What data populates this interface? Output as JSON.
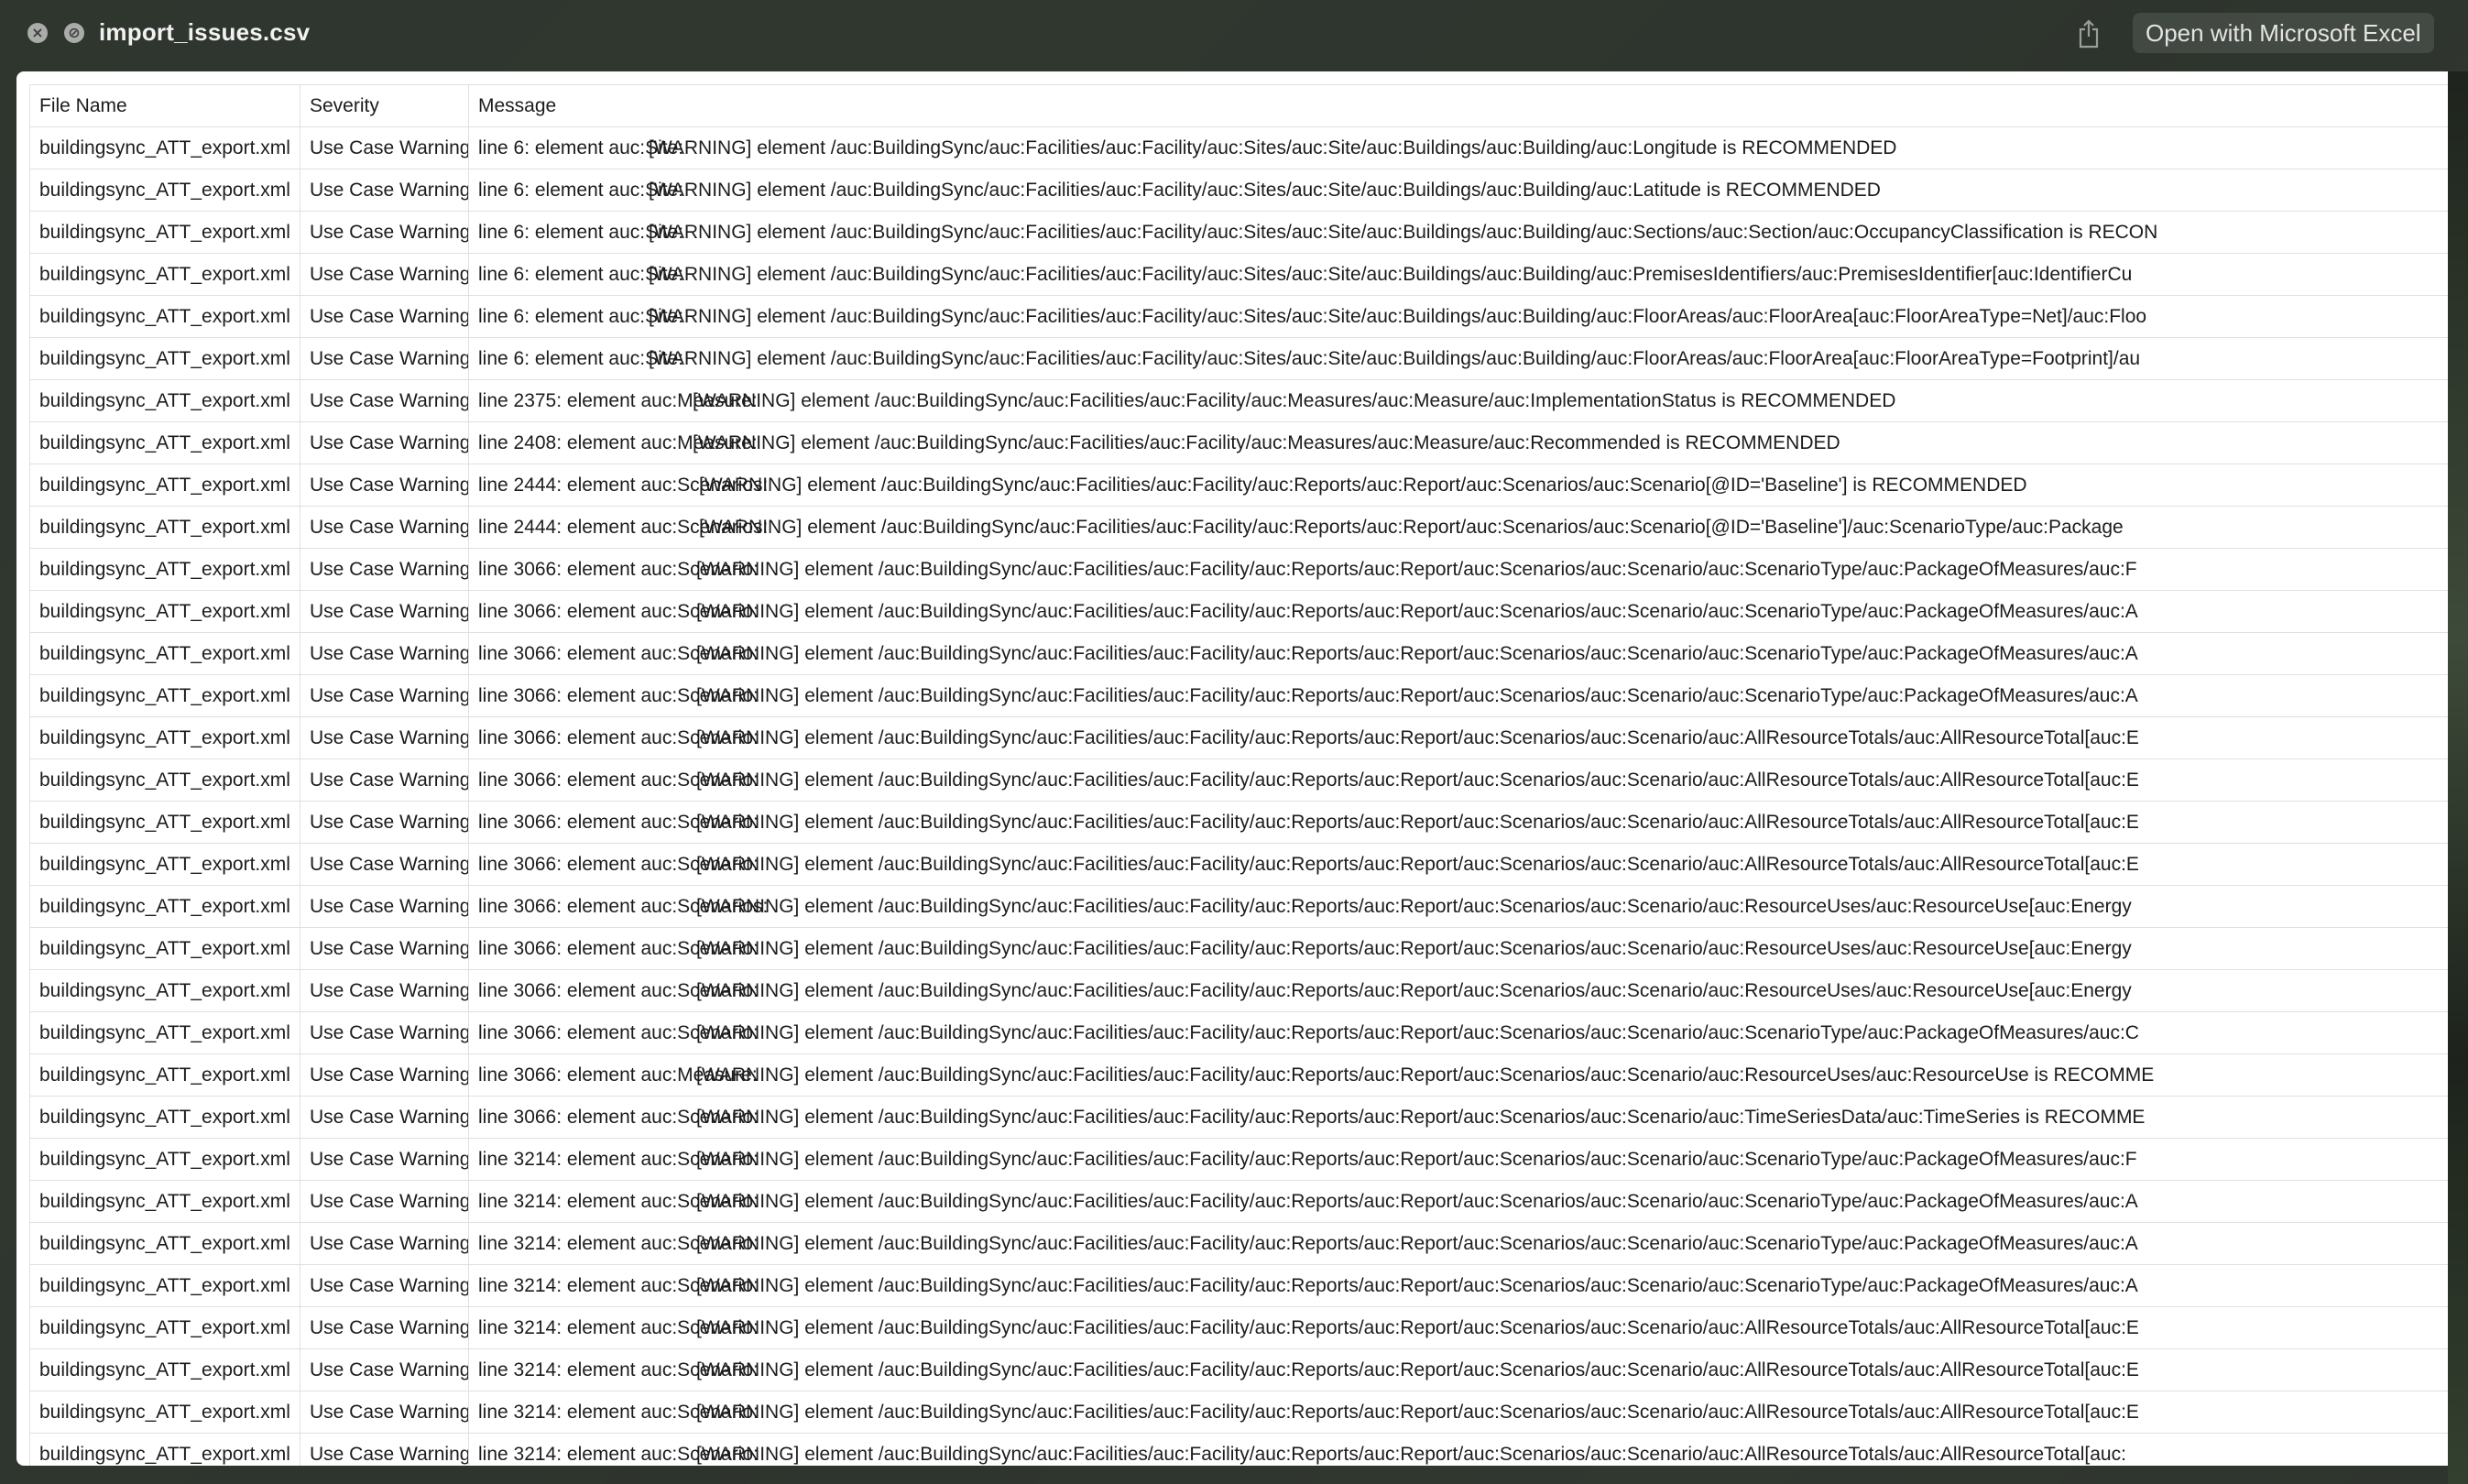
{
  "window": {
    "title": "import_issues.csv",
    "open_button_label": "Open with Microsoft Excel"
  },
  "icons": [
    "close-icon",
    "minimize-icon",
    "share-icon"
  ],
  "table": {
    "columns": [
      "File Name",
      "Severity",
      "Message"
    ],
    "rows": [
      {
        "file": "buildingsync_ATT_export.xml",
        "severity": "Use Case Warning",
        "line": "line 6: element auc:Site:",
        "text": "[WARNING] element /auc:BuildingSync/auc:Facilities/auc:Facility/auc:Sites/auc:Site/auc:Buildings/auc:Building/auc:Longitude is RECOMMENDED"
      },
      {
        "file": "buildingsync_ATT_export.xml",
        "severity": "Use Case Warning",
        "line": "line 6: element auc:Site:",
        "text": "[WARNING] element /auc:BuildingSync/auc:Facilities/auc:Facility/auc:Sites/auc:Site/auc:Buildings/auc:Building/auc:Latitude is RECOMMENDED"
      },
      {
        "file": "buildingsync_ATT_export.xml",
        "severity": "Use Case Warning",
        "line": "line 6: element auc:Site:",
        "text": "[WARNING] element /auc:BuildingSync/auc:Facilities/auc:Facility/auc:Sites/auc:Site/auc:Buildings/auc:Building/auc:Sections/auc:Section/auc:OccupancyClassification is RECON"
      },
      {
        "file": "buildingsync_ATT_export.xml",
        "severity": "Use Case Warning",
        "line": "line 6: element auc:Site:",
        "text": "[WARNING] element /auc:BuildingSync/auc:Facilities/auc:Facility/auc:Sites/auc:Site/auc:Buildings/auc:Building/auc:PremisesIdentifiers/auc:PremisesIdentifier[auc:IdentifierCu"
      },
      {
        "file": "buildingsync_ATT_export.xml",
        "severity": "Use Case Warning",
        "line": "line 6: element auc:Site:",
        "text": "[WARNING] element /auc:BuildingSync/auc:Facilities/auc:Facility/auc:Sites/auc:Site/auc:Buildings/auc:Building/auc:FloorAreas/auc:FloorArea[auc:FloorAreaType=Net]/auc:Floo"
      },
      {
        "file": "buildingsync_ATT_export.xml",
        "severity": "Use Case Warning",
        "line": "line 6: element auc:Site:",
        "text": "[WARNING] element /auc:BuildingSync/auc:Facilities/auc:Facility/auc:Sites/auc:Site/auc:Buildings/auc:Building/auc:FloorAreas/auc:FloorArea[auc:FloorAreaType=Footprint]/au"
      },
      {
        "file": "buildingsync_ATT_export.xml",
        "severity": "Use Case Warning",
        "line": "line 2375: element auc:Measure:",
        "text": "[WARNING] element /auc:BuildingSync/auc:Facilities/auc:Facility/auc:Measures/auc:Measure/auc:ImplementationStatus is RECOMMENDED"
      },
      {
        "file": "buildingsync_ATT_export.xml",
        "severity": "Use Case Warning",
        "line": "line 2408: element auc:Measure:",
        "text": "[WARNING] element /auc:BuildingSync/auc:Facilities/auc:Facility/auc:Measures/auc:Measure/auc:Recommended is RECOMMENDED"
      },
      {
        "file": "buildingsync_ATT_export.xml",
        "severity": "Use Case Warning",
        "line": "line 2444: element auc:Scenarios:",
        "text": "[WARNING] element /auc:BuildingSync/auc:Facilities/auc:Facility/auc:Reports/auc:Report/auc:Scenarios/auc:Scenario[@ID='Baseline'] is RECOMMENDED"
      },
      {
        "file": "buildingsync_ATT_export.xml",
        "severity": "Use Case Warning",
        "line": "line 2444: element auc:Scenarios:",
        "text": "[WARNING] element /auc:BuildingSync/auc:Facilities/auc:Facility/auc:Reports/auc:Report/auc:Scenarios/auc:Scenario[@ID='Baseline']/auc:ScenarioType/auc:Package"
      },
      {
        "file": "buildingsync_ATT_export.xml",
        "severity": "Use Case Warning",
        "line": "line 3066: element auc:Scenario:",
        "text": "[WARNING] element /auc:BuildingSync/auc:Facilities/auc:Facility/auc:Reports/auc:Report/auc:Scenarios/auc:Scenario/auc:ScenarioType/auc:PackageOfMeasures/auc:F"
      },
      {
        "file": "buildingsync_ATT_export.xml",
        "severity": "Use Case Warning",
        "line": "line 3066: element auc:Scenario:",
        "text": "[WARNING] element /auc:BuildingSync/auc:Facilities/auc:Facility/auc:Reports/auc:Report/auc:Scenarios/auc:Scenario/auc:ScenarioType/auc:PackageOfMeasures/auc:A"
      },
      {
        "file": "buildingsync_ATT_export.xml",
        "severity": "Use Case Warning",
        "line": "line 3066: element auc:Scenario:",
        "text": "[WARNING] element /auc:BuildingSync/auc:Facilities/auc:Facility/auc:Reports/auc:Report/auc:Scenarios/auc:Scenario/auc:ScenarioType/auc:PackageOfMeasures/auc:A"
      },
      {
        "file": "buildingsync_ATT_export.xml",
        "severity": "Use Case Warning",
        "line": "line 3066: element auc:Scenario:",
        "text": "[WARNING] element /auc:BuildingSync/auc:Facilities/auc:Facility/auc:Reports/auc:Report/auc:Scenarios/auc:Scenario/auc:ScenarioType/auc:PackageOfMeasures/auc:A"
      },
      {
        "file": "buildingsync_ATT_export.xml",
        "severity": "Use Case Warning",
        "line": "line 3066: element auc:Scenario:",
        "text": "[WARNING] element /auc:BuildingSync/auc:Facilities/auc:Facility/auc:Reports/auc:Report/auc:Scenarios/auc:Scenario/auc:AllResourceTotals/auc:AllResourceTotal[auc:E"
      },
      {
        "file": "buildingsync_ATT_export.xml",
        "severity": "Use Case Warning",
        "line": "line 3066: element auc:Scenario:",
        "text": "[WARNING] element /auc:BuildingSync/auc:Facilities/auc:Facility/auc:Reports/auc:Report/auc:Scenarios/auc:Scenario/auc:AllResourceTotals/auc:AllResourceTotal[auc:E"
      },
      {
        "file": "buildingsync_ATT_export.xml",
        "severity": "Use Case Warning",
        "line": "line 3066: element auc:Scenario:",
        "text": "[WARNING] element /auc:BuildingSync/auc:Facilities/auc:Facility/auc:Reports/auc:Report/auc:Scenarios/auc:Scenario/auc:AllResourceTotals/auc:AllResourceTotal[auc:E"
      },
      {
        "file": "buildingsync_ATT_export.xml",
        "severity": "Use Case Warning",
        "line": "line 3066: element auc:Scenario:",
        "text": "[WARNING] element /auc:BuildingSync/auc:Facilities/auc:Facility/auc:Reports/auc:Report/auc:Scenarios/auc:Scenario/auc:AllResourceTotals/auc:AllResourceTotal[auc:E"
      },
      {
        "file": "buildingsync_ATT_export.xml",
        "severity": "Use Case Warning",
        "line": "line 3066: element auc:Scenarios:",
        "text": "[WARNING] element /auc:BuildingSync/auc:Facilities/auc:Facility/auc:Reports/auc:Report/auc:Scenarios/auc:Scenario/auc:ResourceUses/auc:ResourceUse[auc:Energy"
      },
      {
        "file": "buildingsync_ATT_export.xml",
        "severity": "Use Case Warning",
        "line": "line 3066: element auc:Scenario:",
        "text": "[WARNING] element /auc:BuildingSync/auc:Facilities/auc:Facility/auc:Reports/auc:Report/auc:Scenarios/auc:Scenario/auc:ResourceUses/auc:ResourceUse[auc:Energy"
      },
      {
        "file": "buildingsync_ATT_export.xml",
        "severity": "Use Case Warning",
        "line": "line 3066: element auc:Scenario:",
        "text": "[WARNING] element /auc:BuildingSync/auc:Facilities/auc:Facility/auc:Reports/auc:Report/auc:Scenarios/auc:Scenario/auc:ResourceUses/auc:ResourceUse[auc:Energy"
      },
      {
        "file": "buildingsync_ATT_export.xml",
        "severity": "Use Case Warning",
        "line": "line 3066: element auc:Scenario:",
        "text": "[WARNING] element /auc:BuildingSync/auc:Facilities/auc:Facility/auc:Reports/auc:Report/auc:Scenarios/auc:Scenario/auc:ScenarioType/auc:PackageOfMeasures/auc:C"
      },
      {
        "file": "buildingsync_ATT_export.xml",
        "severity": "Use Case Warning",
        "line": "line 3066: element auc:Measure:",
        "text": "[WARNING] element /auc:BuildingSync/auc:Facilities/auc:Facility/auc:Reports/auc:Report/auc:Scenarios/auc:Scenario/auc:ResourceUses/auc:ResourceUse is RECOMME"
      },
      {
        "file": "buildingsync_ATT_export.xml",
        "severity": "Use Case Warning",
        "line": "line 3066: element auc:Scenario:",
        "text": "[WARNING] element /auc:BuildingSync/auc:Facilities/auc:Facility/auc:Reports/auc:Report/auc:Scenarios/auc:Scenario/auc:TimeSeriesData/auc:TimeSeries is RECOMME"
      },
      {
        "file": "buildingsync_ATT_export.xml",
        "severity": "Use Case Warning",
        "line": "line 3214: element auc:Scenario:",
        "text": "[WARNING] element /auc:BuildingSync/auc:Facilities/auc:Facility/auc:Reports/auc:Report/auc:Scenarios/auc:Scenario/auc:ScenarioType/auc:PackageOfMeasures/auc:F"
      },
      {
        "file": "buildingsync_ATT_export.xml",
        "severity": "Use Case Warning",
        "line": "line 3214: element auc:Scenario:",
        "text": "[WARNING] element /auc:BuildingSync/auc:Facilities/auc:Facility/auc:Reports/auc:Report/auc:Scenarios/auc:Scenario/auc:ScenarioType/auc:PackageOfMeasures/auc:A"
      },
      {
        "file": "buildingsync_ATT_export.xml",
        "severity": "Use Case Warning",
        "line": "line 3214: element auc:Scenario:",
        "text": "[WARNING] element /auc:BuildingSync/auc:Facilities/auc:Facility/auc:Reports/auc:Report/auc:Scenarios/auc:Scenario/auc:ScenarioType/auc:PackageOfMeasures/auc:A"
      },
      {
        "file": "buildingsync_ATT_export.xml",
        "severity": "Use Case Warning",
        "line": "line 3214: element auc:Scenario:",
        "text": "[WARNING] element /auc:BuildingSync/auc:Facilities/auc:Facility/auc:Reports/auc:Report/auc:Scenarios/auc:Scenario/auc:ScenarioType/auc:PackageOfMeasures/auc:A"
      },
      {
        "file": "buildingsync_ATT_export.xml",
        "severity": "Use Case Warning",
        "line": "line 3214: element auc:Scenario:",
        "text": "[WARNING] element /auc:BuildingSync/auc:Facilities/auc:Facility/auc:Reports/auc:Report/auc:Scenarios/auc:Scenario/auc:AllResourceTotals/auc:AllResourceTotal[auc:E"
      },
      {
        "file": "buildingsync_ATT_export.xml",
        "severity": "Use Case Warning",
        "line": "line 3214: element auc:Scenario:",
        "text": "[WARNING] element /auc:BuildingSync/auc:Facilities/auc:Facility/auc:Reports/auc:Report/auc:Scenarios/auc:Scenario/auc:AllResourceTotals/auc:AllResourceTotal[auc:E"
      },
      {
        "file": "buildingsync_ATT_export.xml",
        "severity": "Use Case Warning",
        "line": "line 3214: element auc:Scenario:",
        "text": "[WARNING] element /auc:BuildingSync/auc:Facilities/auc:Facility/auc:Reports/auc:Report/auc:Scenarios/auc:Scenario/auc:AllResourceTotals/auc:AllResourceTotal[auc:E"
      },
      {
        "file": "buildingsync_ATT_export.xml",
        "severity": "Use Case Warning",
        "line": "line 3214: element auc:Scenario:",
        "text": "[WARNING] element /auc:BuildingSync/auc:Facilities/auc:Facility/auc:Reports/auc:Report/auc:Scenarios/auc:Scenario/auc:AllResourceTotals/auc:AllResourceTotal[auc:"
      }
    ]
  }
}
